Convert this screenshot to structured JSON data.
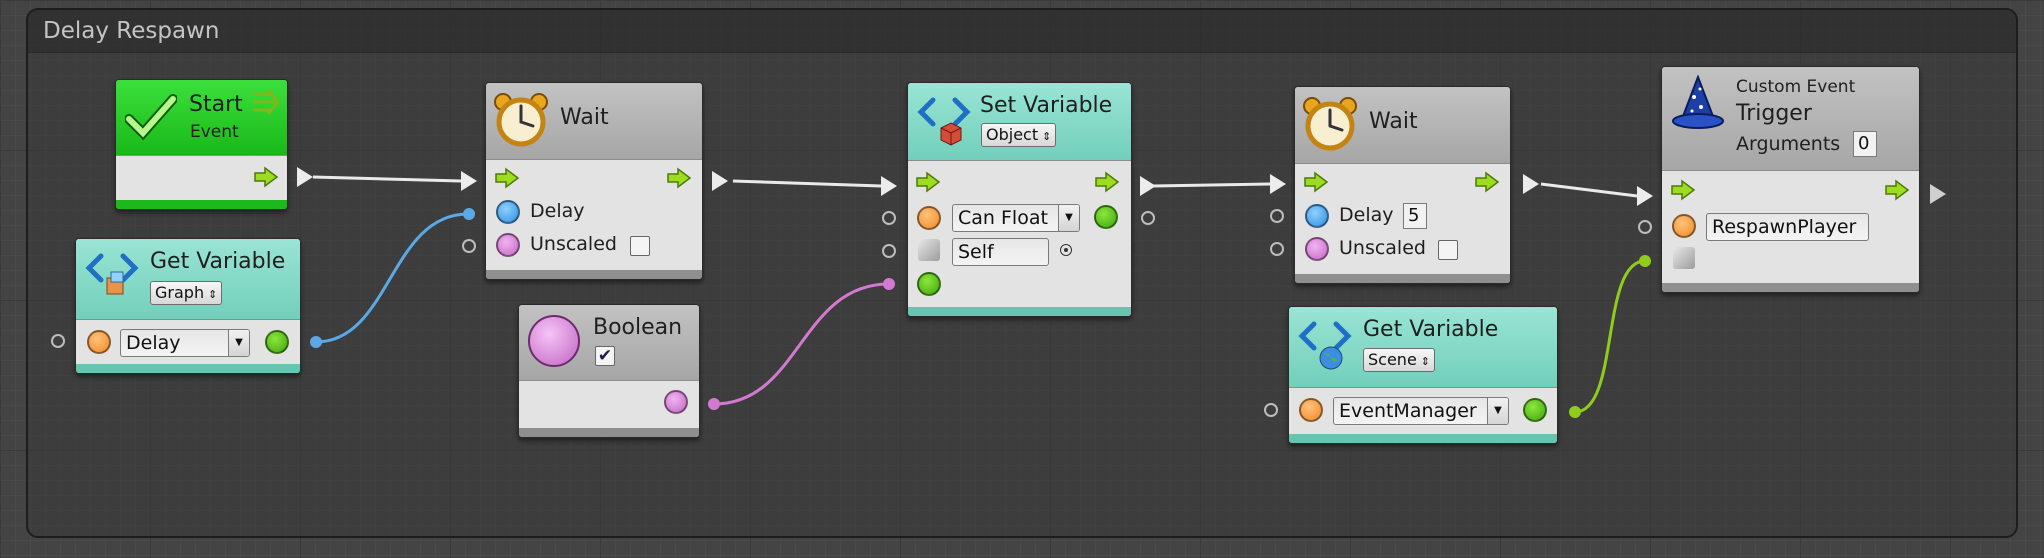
{
  "group": {
    "title": "Delay Respawn"
  },
  "nodes": {
    "start": {
      "title": "Start",
      "subtitle": "Event"
    },
    "get_var_graph": {
      "title": "Get Variable",
      "scope": "Graph",
      "variable": "Delay"
    },
    "wait1": {
      "title": "Wait",
      "delay_label": "Delay",
      "unscaled_label": "Unscaled"
    },
    "boolean": {
      "title": "Boolean",
      "checkmark": "✔"
    },
    "set_var": {
      "title": "Set Variable",
      "scope": "Object",
      "variable": "Can Float",
      "target": "Self"
    },
    "wait2": {
      "title": "Wait",
      "delay_label": "Delay",
      "delay_value": "5",
      "unscaled_label": "Unscaled"
    },
    "get_var_scene": {
      "title": "Get Variable",
      "scope": "Scene",
      "variable": "EventManager"
    },
    "custom_event": {
      "title": "Custom Event",
      "subtitle": "Trigger",
      "arguments_label": "Arguments",
      "arguments_value": "0",
      "event_name": "RespawnPlayer"
    }
  },
  "colors": {
    "control_wire": "#eaeaea",
    "float_wire": "#5aa9e6",
    "bool_wire": "#d27ad2",
    "object_wire": "#8fcc1c",
    "teal_header": "#86dcc8",
    "gray_header": "#b5b5b5",
    "green_header": "#2ccf2c"
  },
  "icons": [
    "checkmark-icon",
    "triple-arrow-icon",
    "alarm-clock-icon",
    "variable-brackets-icon",
    "wizard-hat-icon",
    "control-arrow-icon"
  ]
}
